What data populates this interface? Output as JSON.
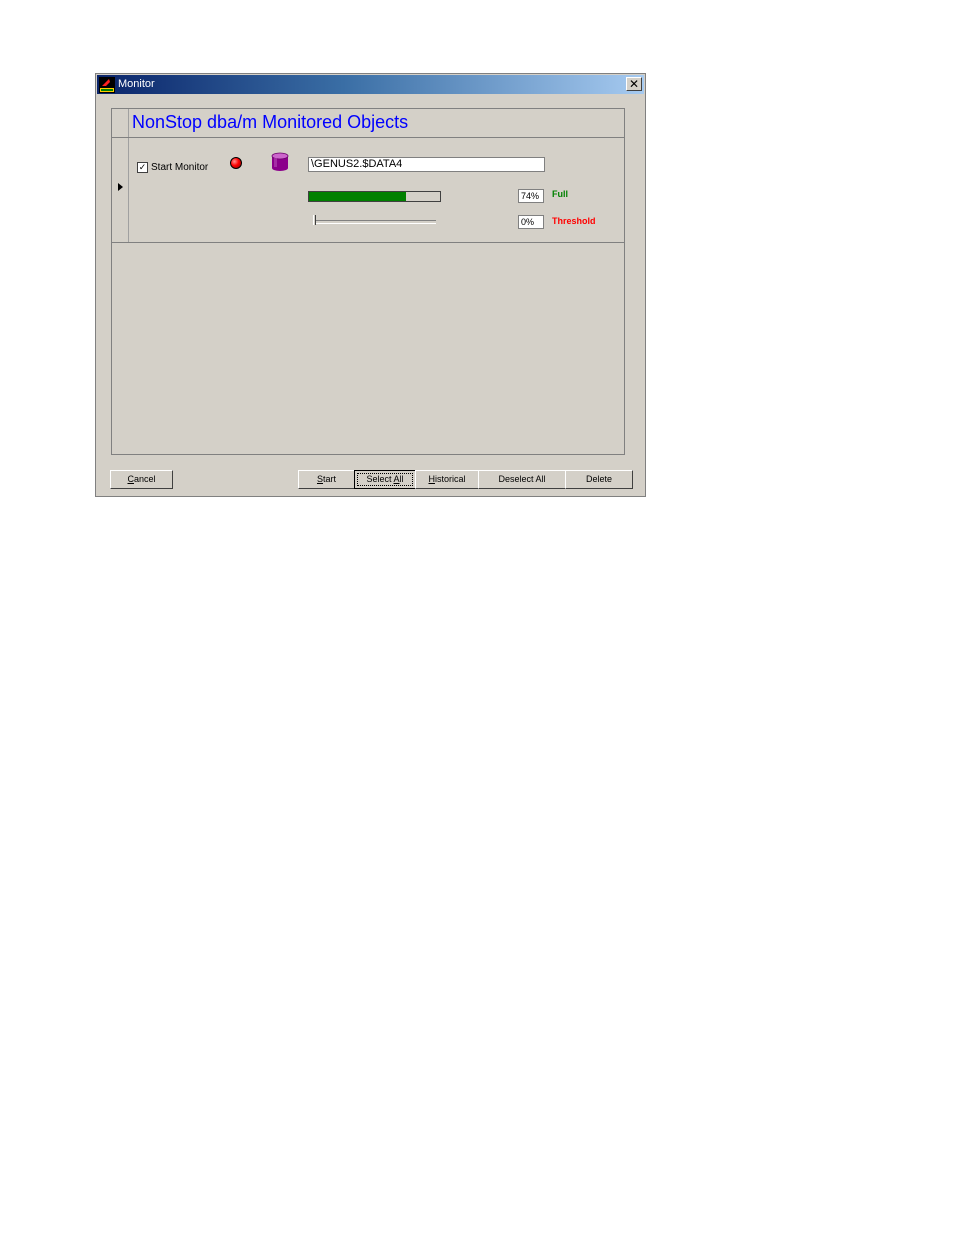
{
  "window": {
    "title": "Monitor",
    "close_glyph": "✕",
    "app_icon": "vonn-logo-icon"
  },
  "header": {
    "title": "NonStop dba/m Monitored Objects"
  },
  "row": {
    "start_monitor_label": "Start Monitor",
    "start_monitor_checked": true,
    "check_glyph": "✓",
    "status_color": "#ff0000",
    "object_name": "\\GENUS2.$DATA4",
    "full": {
      "value_text": "74%",
      "fraction": 0.74,
      "label": "Full",
      "color": "#008000"
    },
    "threshold": {
      "value_text": "0%",
      "fraction": 0.0,
      "label": "Threshold",
      "color": "#ff0000"
    }
  },
  "buttons": {
    "cancel": {
      "pre": "",
      "key": "C",
      "post": "ancel"
    },
    "start": {
      "pre": "",
      "key": "S",
      "post": "tart"
    },
    "select_all": {
      "pre": "Select ",
      "key": "A",
      "post": "ll"
    },
    "historical": {
      "pre": "",
      "key": "H",
      "post": "istorical"
    },
    "deselect_all": {
      "pre": "Deselect All",
      "key": "",
      "post": ""
    },
    "delete": {
      "pre": "Delete",
      "key": "",
      "post": ""
    }
  }
}
